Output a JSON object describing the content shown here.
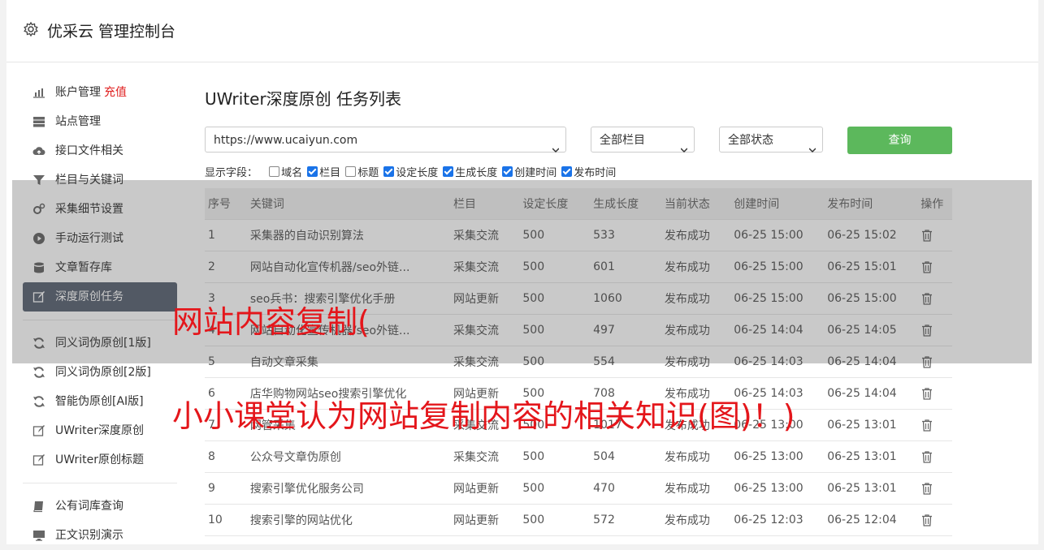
{
  "header": {
    "title": "优采云 管理控制台",
    "icon": "gear-icon"
  },
  "sidebar": {
    "groups": [
      [
        {
          "label": "账户管理",
          "extra": "充值",
          "icon": "bar-chart-icon"
        },
        {
          "label": "站点管理",
          "icon": "server-icon"
        },
        {
          "label": "接口文件相关",
          "icon": "cloud-upload-icon"
        },
        {
          "label": "栏目与关键词",
          "icon": "filter-icon"
        },
        {
          "label": "采集细节设置",
          "icon": "cogs-icon"
        },
        {
          "label": "手动运行测试",
          "icon": "play-icon"
        },
        {
          "label": "文章暂存库",
          "icon": "database-icon"
        },
        {
          "label": "深度原创任务",
          "icon": "edit-icon",
          "active": true
        }
      ],
      [
        {
          "label": "同义词伪原创[1版]",
          "icon": "refresh-icon"
        },
        {
          "label": "同义词伪原创[2版]",
          "icon": "refresh-icon"
        },
        {
          "label": "智能伪原创[AI版]",
          "icon": "refresh-icon"
        },
        {
          "label": "UWriter深度原创",
          "icon": "edit-icon"
        },
        {
          "label": "UWriter原创标题",
          "icon": "edit-icon"
        }
      ],
      [
        {
          "label": "公有词库查询",
          "icon": "book-icon"
        },
        {
          "label": "正文识别演示",
          "icon": "monitor-icon"
        }
      ]
    ]
  },
  "main": {
    "title": "UWriter深度原创 任务列表",
    "site_select": "https://www.ucaiyun.com",
    "column_select": "全部栏目",
    "status_select": "全部状态",
    "query_button": "查询",
    "fields_label": "显示字段：",
    "fields": [
      {
        "label": "域名",
        "checked": false
      },
      {
        "label": "栏目",
        "checked": true
      },
      {
        "label": "标题",
        "checked": false
      },
      {
        "label": "设定长度",
        "checked": true
      },
      {
        "label": "生成长度",
        "checked": true
      },
      {
        "label": "创建时间",
        "checked": true
      },
      {
        "label": "发布时间",
        "checked": true
      }
    ]
  },
  "table": {
    "headers": [
      "序号",
      "关键词",
      "栏目",
      "设定长度",
      "生成长度",
      "当前状态",
      "创建时间",
      "发布时间",
      "操作"
    ],
    "rows": [
      [
        "1",
        "采集器的自动识别算法",
        "采集交流",
        "500",
        "533",
        "发布成功",
        "06-25 15:00",
        "06-25 15:02"
      ],
      [
        "2",
        "网站自动化宣传机器/seo外链...",
        "采集交流",
        "500",
        "601",
        "发布成功",
        "06-25 15:00",
        "06-25 15:01"
      ],
      [
        "3",
        "seo兵书：搜索引擎优化手册",
        "网站更新",
        "500",
        "1060",
        "发布成功",
        "06-25 15:00",
        "06-25 15:00"
      ],
      [
        "4",
        "网站自动化宣传机器/seo外链...",
        "采集交流",
        "500",
        "497",
        "发布成功",
        "06-25 14:04",
        "06-25 14:05"
      ],
      [
        "5",
        "自动文章采集",
        "采集交流",
        "500",
        "554",
        "发布成功",
        "06-25 14:03",
        "06-25 14:04"
      ],
      [
        "6",
        "店华购物网站seo搜索引擎优化",
        "网站更新",
        "500",
        "708",
        "发布成功",
        "06-25 14:03",
        "06-25 14:04"
      ],
      [
        "7",
        "网管采集",
        "采集交流",
        "500",
        "1017",
        "发布成功",
        "06-25 13:00",
        "06-25 13:01"
      ],
      [
        "8",
        "公众号文章伪原创",
        "采集交流",
        "500",
        "504",
        "发布成功",
        "06-25 13:00",
        "06-25 13:01"
      ],
      [
        "9",
        "搜索引擎优化服务公司",
        "网站更新",
        "500",
        "470",
        "发布成功",
        "06-25 13:00",
        "06-25 13:01"
      ],
      [
        "10",
        "搜索引擎的网站优化",
        "网站更新",
        "500",
        "572",
        "发布成功",
        "06-25 12:03",
        "06-25 12:04"
      ]
    ],
    "action_icon": "trash-icon"
  },
  "watermark": {
    "line1": "网站内容复制(",
    "line2": "小小课堂认为网站复制内容的相关知识(图)！)",
    "color": "#e4161b"
  }
}
